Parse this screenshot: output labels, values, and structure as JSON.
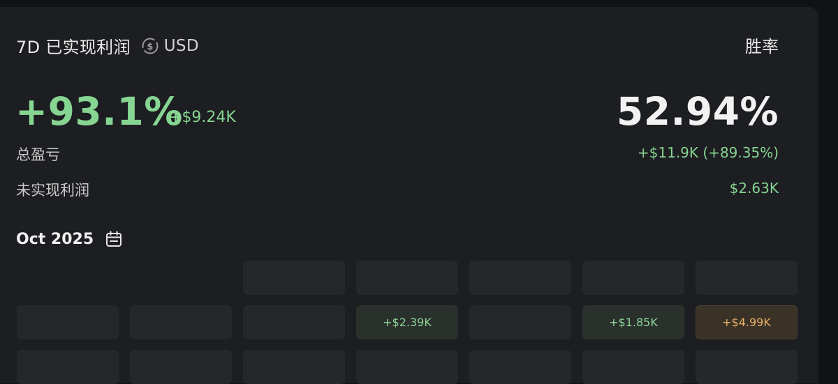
{
  "header": {
    "title": "7D 已实现利润",
    "currency": "USD",
    "currency_icon": "usd-cycle-icon",
    "winrate_label": "胜率"
  },
  "summary": {
    "pnl_percent": "+93.1%",
    "pnl_amount": "+$9.24K",
    "winrate": "52.94%",
    "total_pnl_label": "总盈亏",
    "total_pnl_value": "+$11.9K (+89.35%)",
    "unrealized_label": "未实现利润",
    "unrealized_value": "$2.63K"
  },
  "calendar": {
    "month": "Oct 2025",
    "icon": "calendar-icon",
    "rows": [
      [
        "",
        "",
        "",
        "",
        "",
        "",
        ""
      ],
      [
        "",
        "",
        "",
        "+$2.39K",
        "",
        "+$1.85K",
        "+$4.99K"
      ],
      [
        "",
        "",
        "",
        "",
        "",
        "",
        ""
      ]
    ]
  },
  "colors": {
    "background": "#1d1e21",
    "positive": "#86d592",
    "highlight": "#e8b166"
  }
}
